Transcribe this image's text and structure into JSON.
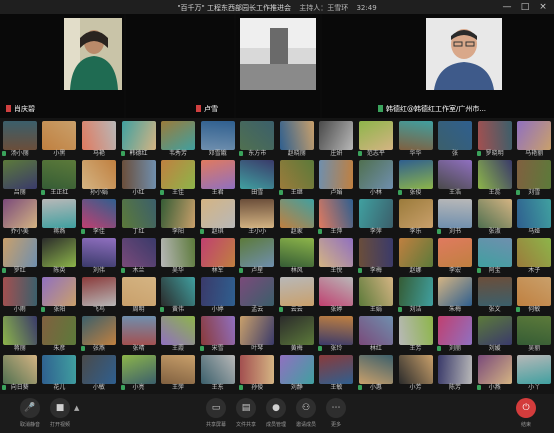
{
  "window": {
    "title": "\"百千万\" 工程东西部园长工作推进会",
    "host": "主持人：王雪环",
    "time": "32:49",
    "controls": [
      "—",
      "□",
      "×"
    ]
  },
  "videos": [
    {
      "name": "肖庆碧",
      "mic": "muted"
    },
    {
      "name": "卢雪",
      "mic": "muted"
    },
    {
      "name": "",
      "mic": ""
    },
    {
      "name": "韩德红@韩德红工作室/广州市...",
      "mic": "active"
    }
  ],
  "participants": [
    "汤小丽",
    "小黑",
    "马艳",
    "韩德红",
    "韦秀芳",
    "邓雪娥",
    "东方市",
    "赵晓丽",
    "庄妍",
    "范志平",
    "华华",
    "张",
    "罗晓明",
    "马艳丽",
    "吕丽",
    "王正红",
    "孙小娟",
    "小红",
    "王佳",
    "王君",
    "田雪",
    "王继",
    "卢娟",
    "小林",
    "张俊",
    "王浩",
    "王蕊",
    "刘雪",
    "乔小美",
    "蒋燕",
    "李佳",
    "丁红",
    "李阳",
    "赵琪",
    "王小小",
    "赵家",
    "王萍",
    "李萍",
    "李乐",
    "刘书",
    "张淑",
    "马娅",
    "罗红",
    "陈英",
    "刘伟",
    "木兰",
    "吴华",
    "林军",
    "卢星",
    "林风",
    "王悦",
    "李梅",
    "赵娜",
    "李宏",
    "阿宝",
    "木子",
    "小雨",
    "张阳",
    "飞鸟",
    "周明",
    "黄伟",
    "小婷",
    "孟云",
    "云云",
    "张婷",
    "王娟",
    "刘洁",
    "朱梅",
    "张文",
    "何敏",
    "蒋丽",
    "朱彦",
    "张燕",
    "张晴",
    "王霞",
    "宋雪",
    "叶琴",
    "黄梅",
    "张玲",
    "林红",
    "王芳",
    "刘丽",
    "刘媛",
    "吴丽",
    "向日葵",
    "花儿",
    "小敏",
    "小亮",
    "王萍",
    "王东",
    "孙俊",
    "刘静",
    "王敏",
    "小惠",
    "小芳",
    "陈芳",
    "小燕",
    "小丫",
    "刘燕",
    "王亮",
    "杨琴",
    "黄芳",
    "刘娇",
    "王静",
    "小王",
    "张云",
    "李明",
    "王俊",
    "张丹",
    "刘凤",
    "孙伟",
    "马琴"
  ],
  "toolbar": {
    "left": [
      {
        "label": "取消静音",
        "icon": "mic-muted-icon"
      },
      {
        "label": "打开视频",
        "icon": "camera-off-icon"
      }
    ],
    "center": [
      {
        "label": "共享屏幕",
        "icon": "share-screen-icon"
      },
      {
        "label": "文件共享",
        "icon": "file-share-icon"
      },
      {
        "label": "成员管理",
        "icon": "person-icon"
      },
      {
        "label": "邀请成员",
        "icon": "people-icon"
      },
      {
        "label": "更多",
        "icon": "more-icon"
      }
    ],
    "right": {
      "label": "结束",
      "icon": "power-icon"
    }
  },
  "colors": {
    "avatars": [
      "#6b4e3a",
      "#2f5f8f",
      "#8a3a3a",
      "#5c7a3a",
      "#9b7b3b",
      "#3b5f6b",
      "#7a4a7a",
      "#c08040",
      "#4a4a4a",
      "#c9a06b",
      "#355c35",
      "#6f8fae",
      "#a35050",
      "#b8b8b8",
      "#e07a5f",
      "#8db54a",
      "#2b2b2b",
      "#d4b483",
      "#507050",
      "#9070c0",
      "#c04070",
      "#40a0a0",
      "#806040",
      "#3a3a6a"
    ],
    "mic_active": "#3aa35c",
    "mic_muted": "#d04040",
    "end": "#d33c3c"
  }
}
